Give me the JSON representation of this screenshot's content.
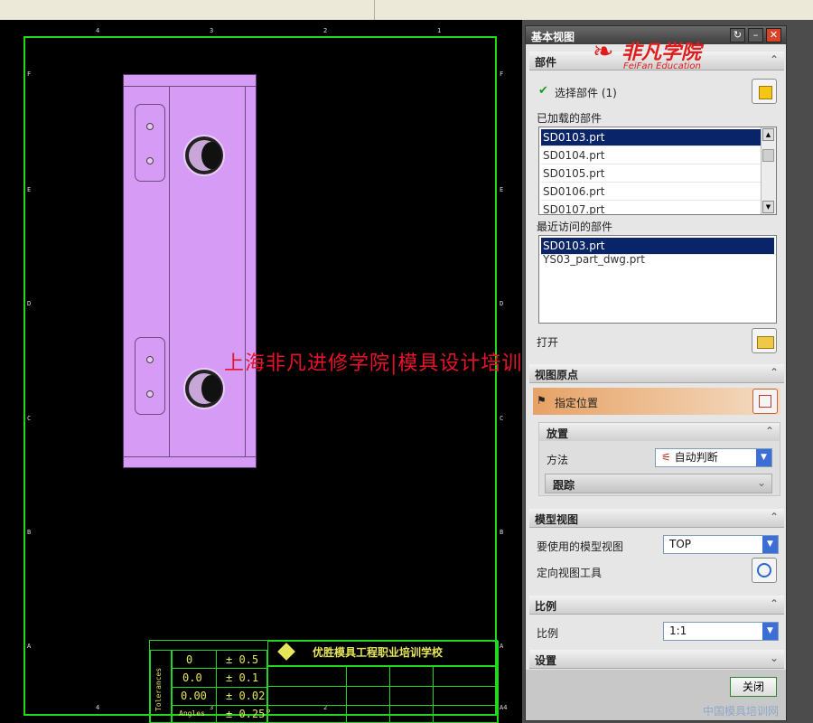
{
  "dialog": {
    "title": "基本视图",
    "reset_icon": "refresh-icon",
    "minimize_icon": "minimize-icon",
    "close_icon": "close-icon"
  },
  "brand": {
    "name": "非凡学院",
    "sub": "FeiFan Education"
  },
  "watermark": "上海非凡进修学院|模具设计培训",
  "part_section": {
    "header": "部件",
    "select_label": "选择部件 (1)",
    "loaded_label": "已加载的部件",
    "loaded": [
      "SD0103.prt",
      "SD0104.prt",
      "SD0105.prt",
      "SD0106.prt",
      "SD0107.prt"
    ],
    "loaded_selected": 0,
    "recent_label": "最近访问的部件",
    "recent": [
      "SD0103.prt",
      "YS03_part_dwg.prt"
    ],
    "open_label": "打开"
  },
  "origin_section": {
    "header": "视图原点",
    "specify_label": "指定位置",
    "placement_header": "放置",
    "method_label": "方法",
    "method_value": "自动判断",
    "track_header": "跟踪"
  },
  "model_view_section": {
    "header": "模型视图",
    "view_label": "要使用的模型视图",
    "view_value": "TOP",
    "orient_label": "定向视图工具"
  },
  "scale_section": {
    "header": "比例",
    "scale_label": "比例",
    "scale_value": "1:1"
  },
  "settings_section": {
    "header": "设置"
  },
  "close_button": "关闭",
  "drawing": {
    "zones_top": [
      "4",
      "3",
      "2",
      "1"
    ],
    "zones_left": [
      "F",
      "E",
      "D",
      "C",
      "B",
      "A"
    ],
    "corner_label": "A4",
    "tolerance": [
      [
        "0",
        "± 0.5"
      ],
      [
        "0.0",
        "± 0.1"
      ],
      [
        "0.00",
        "± 0.02"
      ],
      [
        "Angles",
        "± 0.25°"
      ]
    ],
    "tolerance_caption": "Tolerances",
    "school_name": "优胜模具工程职业培训学校"
  },
  "footer_watermark": "中国模具培训网",
  "colors": {
    "part_fill": "#d69bf4",
    "border_green": "#22d722",
    "selection": "#0a246a",
    "watermark_red": "#e8132a"
  }
}
